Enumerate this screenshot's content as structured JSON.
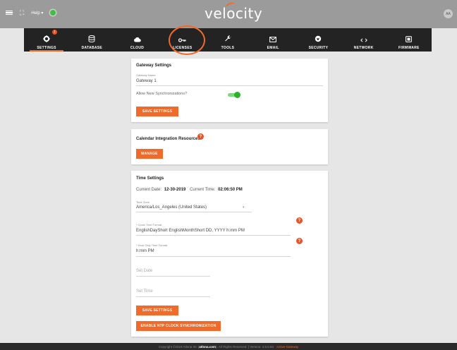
{
  "header": {
    "help_label": "Help ▾",
    "logo_text": "velocity",
    "avatar_initials": "AA"
  },
  "nav": [
    {
      "label": "SETTINGS",
      "icon": "gear-icon"
    },
    {
      "label": "DATABASE",
      "icon": "database-icon"
    },
    {
      "label": "CLOUD",
      "icon": "cloud-icon"
    },
    {
      "label": "LICENSES",
      "icon": "key-icon"
    },
    {
      "label": "TOOLS",
      "icon": "wrench-icon"
    },
    {
      "label": "EMAIL",
      "icon": "envelope-icon"
    },
    {
      "label": "SECURITY",
      "icon": "shield-icon"
    },
    {
      "label": "NETWORK",
      "icon": "network-arrows-icon"
    },
    {
      "label": "FIRMWARE",
      "icon": "chip-icon"
    }
  ],
  "nav_badge": "!",
  "gateway": {
    "title": "Gateway Settings",
    "name_label": "Gateway Name",
    "name_value": "Gateway 1",
    "allow_label": "Allow New Synchronizations?",
    "save_label": "SAVE SETTINGS"
  },
  "calendar": {
    "title": "Calendar Integration Resources",
    "manage_label": "MANAGE",
    "help": "?"
  },
  "time": {
    "title": "Time Settings",
    "current_date_label": "Current Date:",
    "current_date": "12-30-2019",
    "current_time_label": "Current Time:",
    "current_time": "02:06:50 PM",
    "zone_label": "Time Zone",
    "zone_value": "America/Los_Angeles (United States)",
    "clock_label": "* Clock Time Format",
    "clock_value": "EnglishDayShort EnglishMonthShort DD, YYYY h:mm PM",
    "hour_label": "* Hour Only Time Format",
    "hour_value": "h:mm PM",
    "set_date_placeholder": "Set Date",
    "set_time_placeholder": "Set Time",
    "save_label": "SAVE SETTINGS",
    "ntp_label": "ENABLE NTP CLOCK SYNCHRONIZATION",
    "help": "?"
  },
  "footer": {
    "copyright": "Copyright ©2019 Atlona Inc (",
    "link": "atlona.com",
    "rest": "). All Rights Reserved. | Version: 2.0.0.53",
    "active": "Active Gateway"
  },
  "colors": {
    "accent": "#f06a2c",
    "nav_bg": "#232323",
    "header_bg": "#9b9b9b"
  }
}
